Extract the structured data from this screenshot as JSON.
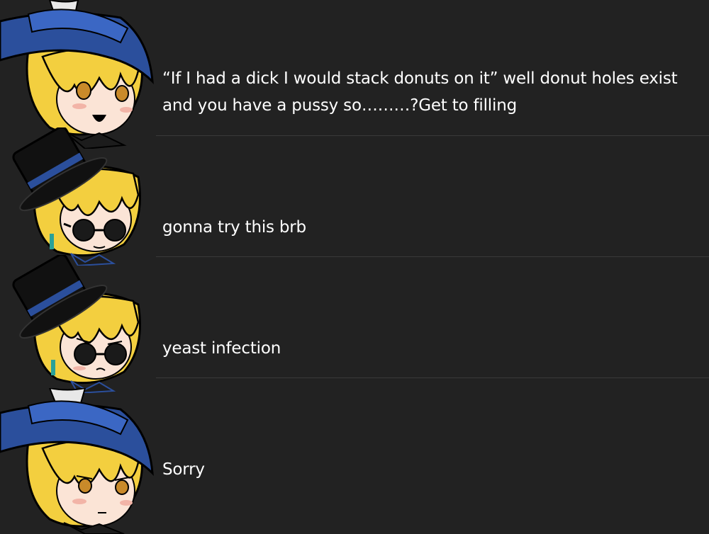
{
  "messages": [
    {
      "avatar": "witch-hat-blonde-character-smiling-icon",
      "text": "“If I had a dick I would stack donuts on it” well donut holes exist and you have a pussy so………?Get to filling"
    },
    {
      "avatar": "top-hat-blonde-character-sunglasses-icon",
      "text": "gonna try this brb"
    },
    {
      "avatar": "top-hat-blonde-character-sunglasses-nervous-icon",
      "text": "yeast infection"
    },
    {
      "avatar": "witch-hat-blonde-character-sad-icon",
      "text": "Sorry"
    }
  ],
  "colors": {
    "background": "#222222",
    "divider": "#3a3a3a",
    "text": "#ffffff",
    "hat_blue": "#2b4f9c",
    "hair_yellow": "#f3cf3f",
    "hat_black": "#111111"
  }
}
